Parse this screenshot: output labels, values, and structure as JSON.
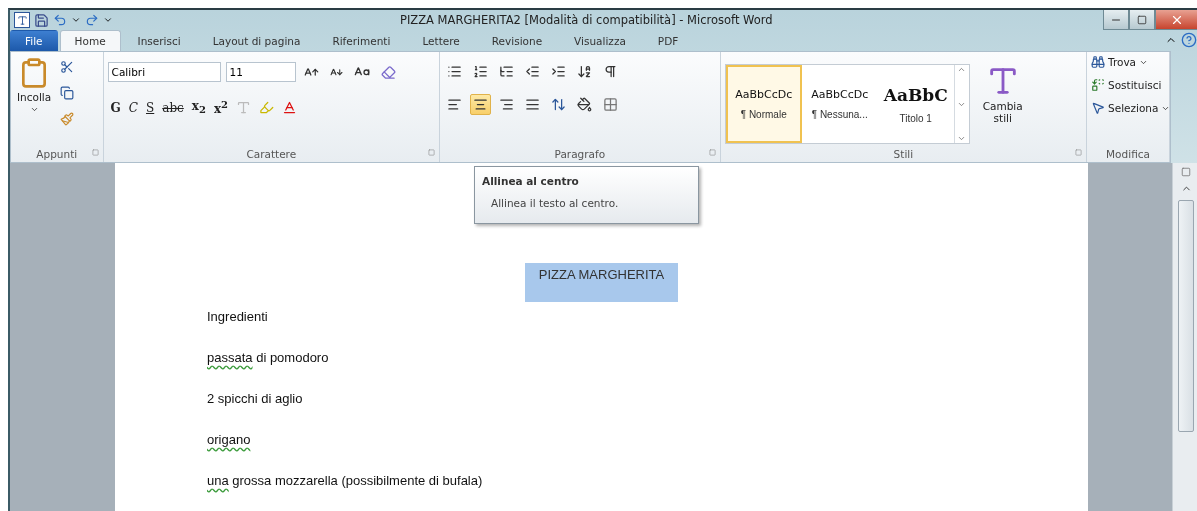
{
  "window": {
    "title": "PIZZA MARGHERITA2 [Modalità di compatibilità] - Microsoft Word"
  },
  "tabs": [
    {
      "label": "File",
      "kind": "file",
      "selected": false
    },
    {
      "label": "Home",
      "kind": "tab",
      "selected": true
    },
    {
      "label": "Inserisci",
      "kind": "tab",
      "selected": false
    },
    {
      "label": "Layout di pagina",
      "kind": "tab",
      "selected": false
    },
    {
      "label": "Riferimenti",
      "kind": "tab",
      "selected": false
    },
    {
      "label": "Lettere",
      "kind": "tab",
      "selected": false
    },
    {
      "label": "Revisione",
      "kind": "tab",
      "selected": false
    },
    {
      "label": "Visualizza",
      "kind": "tab",
      "selected": false
    },
    {
      "label": "PDF",
      "kind": "tab",
      "selected": false
    }
  ],
  "ribbon": {
    "clipboard": {
      "label": "Appunti",
      "paste": "Incolla"
    },
    "font": {
      "label": "Carattere",
      "family": "Calibri",
      "size": "11",
      "format_buttons": [
        {
          "text": "G",
          "kind": "bold"
        },
        {
          "text": "C",
          "kind": "italic"
        },
        {
          "text": "S",
          "kind": "underline"
        },
        {
          "text": "abc",
          "kind": "strike"
        },
        {
          "text": "x$_{2}$",
          "kind": "plain"
        },
        {
          "text": "x$^{2}$",
          "kind": "plain"
        }
      ]
    },
    "paragraph": {
      "label": "Paragrafo",
      "align_buttons": [
        {
          "selected": false
        },
        {
          "selected": true
        },
        {
          "selected": false
        },
        {
          "selected": false
        }
      ]
    },
    "styles": {
      "label": "Stili",
      "items": [
        {
          "sample": "AaBbCcDc",
          "name": "¶ Normale",
          "kind": "normal",
          "selected": true
        },
        {
          "sample": "AaBbCcDc",
          "name": "¶ Nessuna...",
          "kind": "normal",
          "selected": false
        },
        {
          "sample": "AaBbC",
          "name": "Titolo 1",
          "kind": "heading",
          "selected": false
        }
      ],
      "change": "Cambia stili"
    },
    "editing": {
      "label": "Modifica",
      "buttons": [
        {
          "label": "Trova",
          "dropdown": true,
          "kind": "find"
        },
        {
          "label": "Sostituisci",
          "dropdown": false,
          "kind": "replace"
        },
        {
          "label": "Seleziona",
          "dropdown": true,
          "kind": "select"
        }
      ]
    }
  },
  "tooltip": {
    "title": "Allinea al centro",
    "text": "Allinea il testo al centro."
  },
  "document": {
    "heading": {
      "text": "PIZZA MARGHERITA",
      "selected": true
    },
    "paragraphs": [
      [
        {
          "text": "Ingredienti",
          "misspelled": false
        }
      ],
      [
        {
          "text": "passata",
          "misspelled": true
        },
        {
          "text": " di pomodoro",
          "misspelled": false
        }
      ],
      [
        {
          "text": "2 spicchi di aglio",
          "misspelled": false
        }
      ],
      [
        {
          "text": "origano",
          "misspelled": true
        }
      ],
      [
        {
          "text": "una",
          "misspelled": true
        },
        {
          "text": " grossa mozzarella (possibilmente di bufala)",
          "misspelled": false
        }
      ]
    ]
  }
}
